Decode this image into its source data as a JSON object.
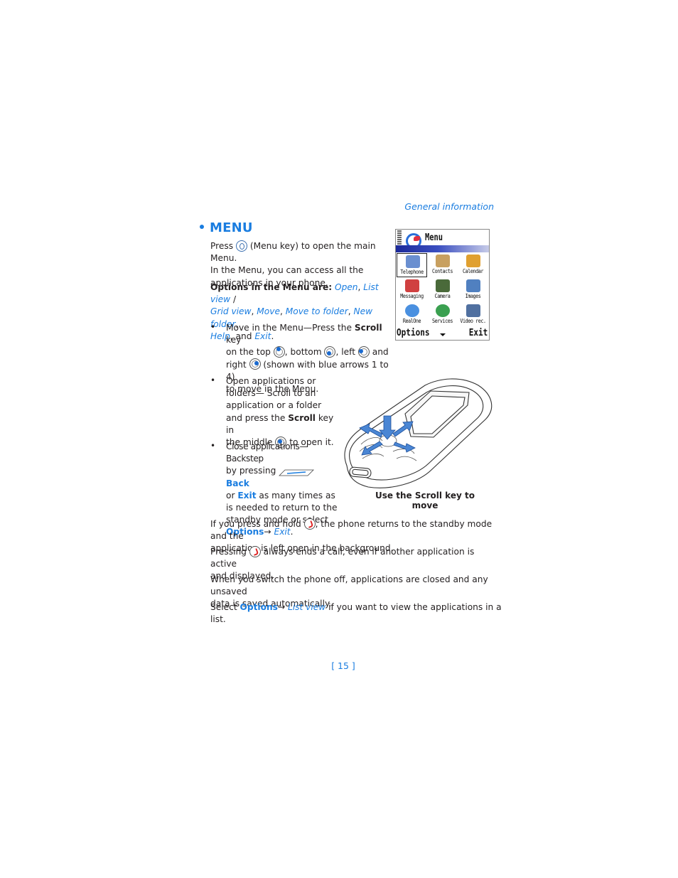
{
  "running_head": "General information",
  "section": {
    "title": "MENU"
  },
  "intro": {
    "press": "Press",
    "menu_key_icon": "menu-key-icon",
    "rest_line1": "(Menu key) to open the main Menu.",
    "line2": "In the Menu, you can access all the",
    "line3": "applications in your phone."
  },
  "options_para": {
    "label": "Options in the Menu are:",
    "items": [
      "Open",
      "List view",
      "Grid view",
      "Move",
      "Move to folder",
      "New folder",
      "Help",
      "Exit"
    ],
    "sep_slash": " /",
    "sep_comma": ",",
    "and": ", and",
    "period": "."
  },
  "bullets": [
    {
      "l1a": "Move in the Menu—Press the ",
      "l1b": "Scroll",
      "l1c": " key",
      "l2a": "on the top",
      "l2b": ", bottom",
      "l2c": ", left",
      "l2d": " and",
      "l3a": "right",
      "l3b": " (shown with blue arrows 1 to 4)",
      "l4": "to move in the Menu."
    },
    {
      "l1": "Open applications or",
      "l2": "folders— Scroll to an",
      "l3": "application or a folder",
      "l4a": "and press the ",
      "l4b": "Scroll",
      "l4c": " key in",
      "l5a": "the middle",
      "l5b": " to open it."
    },
    {
      "l1": "Close applications—Backstep",
      "l2a": "by pressing",
      "l2b": "Back",
      "l3a": "or ",
      "l3b": "Exit",
      "l3c": " as many times as",
      "l4": "is needed to return to the",
      "l5": "standby mode or select",
      "l6a": "Options",
      "l6b": "→ ",
      "l6c": "Exit",
      "l6d": "."
    }
  ],
  "bullet_char": "•",
  "figure_caption": "Use the Scroll key to move",
  "screen": {
    "title": "Menu",
    "apps": [
      {
        "label": "Telephone",
        "icon": "telephone-icon",
        "selected": true
      },
      {
        "label": "Contacts",
        "icon": "contacts-icon"
      },
      {
        "label": "Calendar",
        "icon": "calendar-icon"
      },
      {
        "label": "Messaging",
        "icon": "messaging-icon"
      },
      {
        "label": "Camera",
        "icon": "camera-icon"
      },
      {
        "label": "Images",
        "icon": "images-icon"
      },
      {
        "label": "RealOne",
        "icon": "realone-icon"
      },
      {
        "label": "Services",
        "icon": "services-icon"
      },
      {
        "label": "Video rec.",
        "icon": "video-recorder-icon"
      }
    ],
    "softkey_left": "Options",
    "softkey_right": "Exit"
  },
  "paras": {
    "p1a": "If you press and hold",
    "p1b": ", the phone returns to the standby mode and the",
    "p1c": "application is left open in the background.",
    "p2a": "Pressing",
    "p2b": " always ends a call, even if another application is active",
    "p2c": "and displayed.",
    "p3a": "When you switch the phone off, applications are closed and any unsaved",
    "p3b": "data is saved automatically.",
    "p4a": "Select ",
    "p4b": "Options",
    "p4c": "→ ",
    "p4d": "List view",
    "p4e": " if you want to view the applications in a list."
  },
  "page_number": "[ 15 ]",
  "colors": {
    "accent": "#1a7de0",
    "text": "#231f20"
  }
}
